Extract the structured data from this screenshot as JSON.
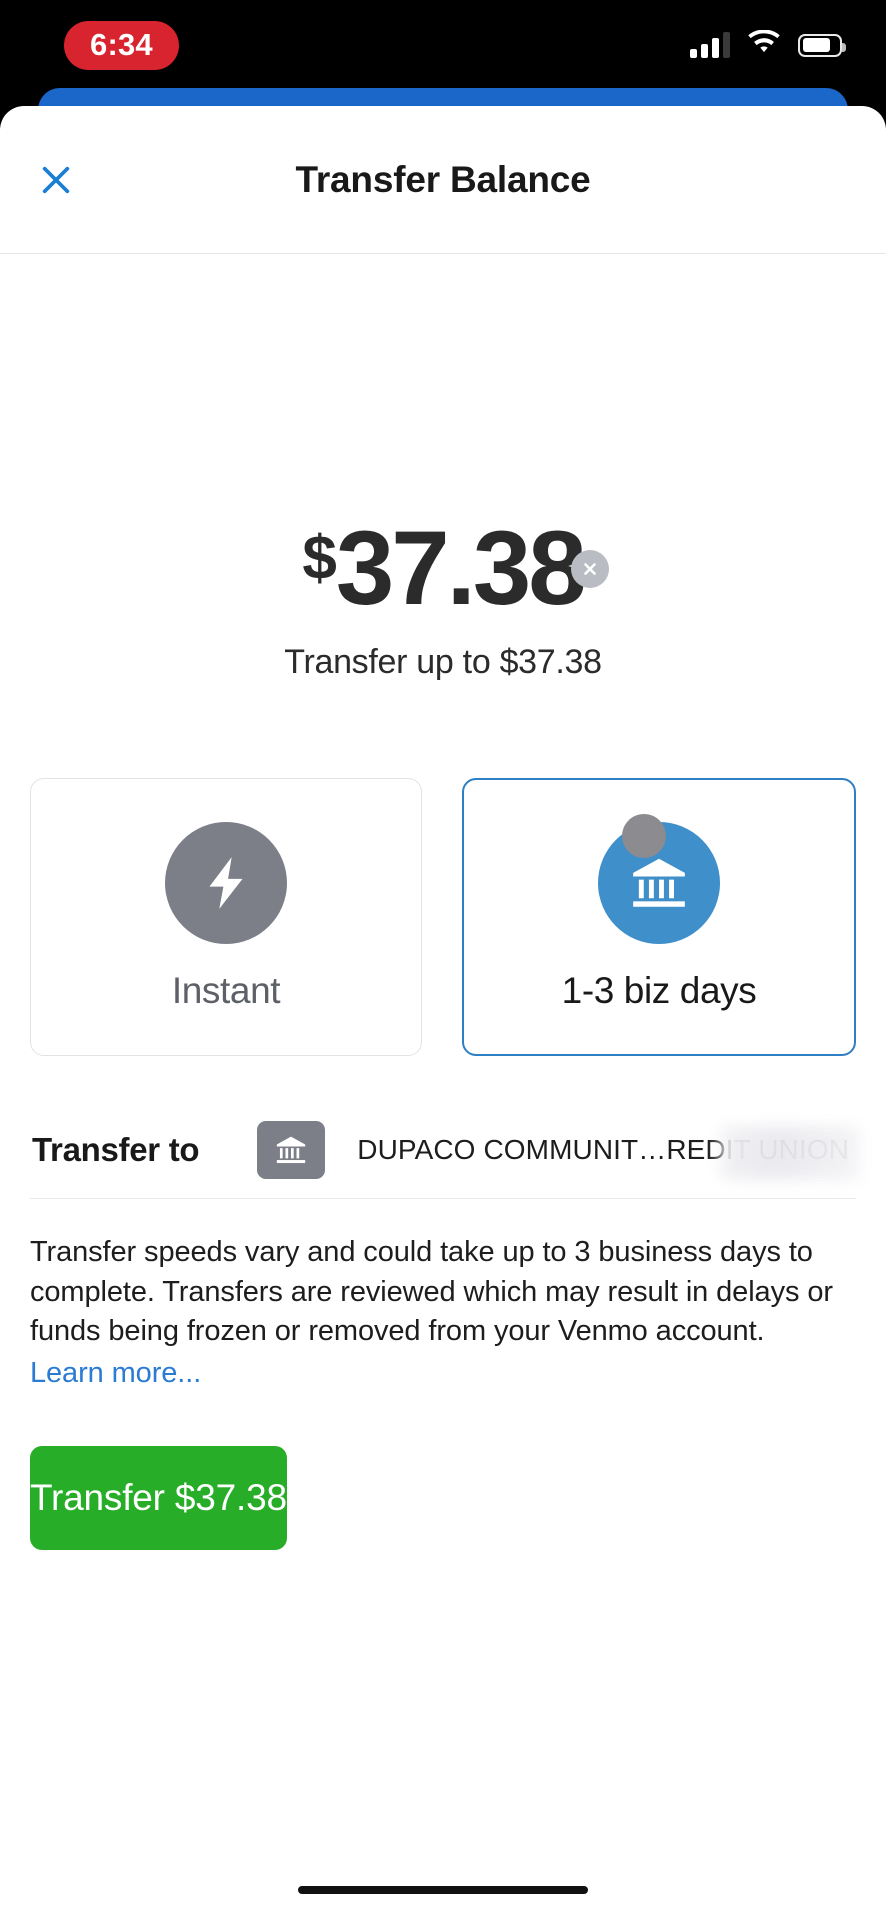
{
  "status_bar": {
    "time": "6:34",
    "time_pill_color": "#d8242f",
    "cellular_icon": "cellular-signal-icon",
    "cellular_bars_filled": 3,
    "cellular_bars_total": 4,
    "wifi_icon": "wifi-icon",
    "battery_icon": "battery-icon",
    "battery_level_percent": 78
  },
  "nav": {
    "title": "Transfer Balance",
    "close_icon": "close-icon",
    "close_color": "#1a7fd4"
  },
  "amount": {
    "currency_symbol": "$",
    "value": "37.38",
    "clear_icon": "clear-circle-icon",
    "subtitle": "Transfer up to $37.38"
  },
  "speed_options": [
    {
      "label": "Instant",
      "icon": "lightning-bolt-icon",
      "icon_bg": "#7c7f88",
      "selected": false
    },
    {
      "label": "1-3 biz days",
      "icon": "bank-icon",
      "icon_bg": "#3f8fca",
      "selected": true
    }
  ],
  "transfer_to": {
    "label": "Transfer to",
    "bank_icon": "bank-icon",
    "destination": "DUPACO COMMUNIT…REDIT UNION",
    "redacted_region": true
  },
  "disclaimer": {
    "text": "Transfer speeds vary and could take up to 3 business days to complete. Transfers are reviewed which may result in delays or funds being frozen or removed from your Venmo account.",
    "link_label": "Learn more...",
    "link_color": "#2b7bd4"
  },
  "cta": {
    "label": "Transfer $37.38",
    "color": "#27ad27"
  },
  "accent_colors": {
    "venmo_blue": "#1b66c9",
    "selected_border": "#2f7fc4",
    "green": "#27ad27"
  }
}
